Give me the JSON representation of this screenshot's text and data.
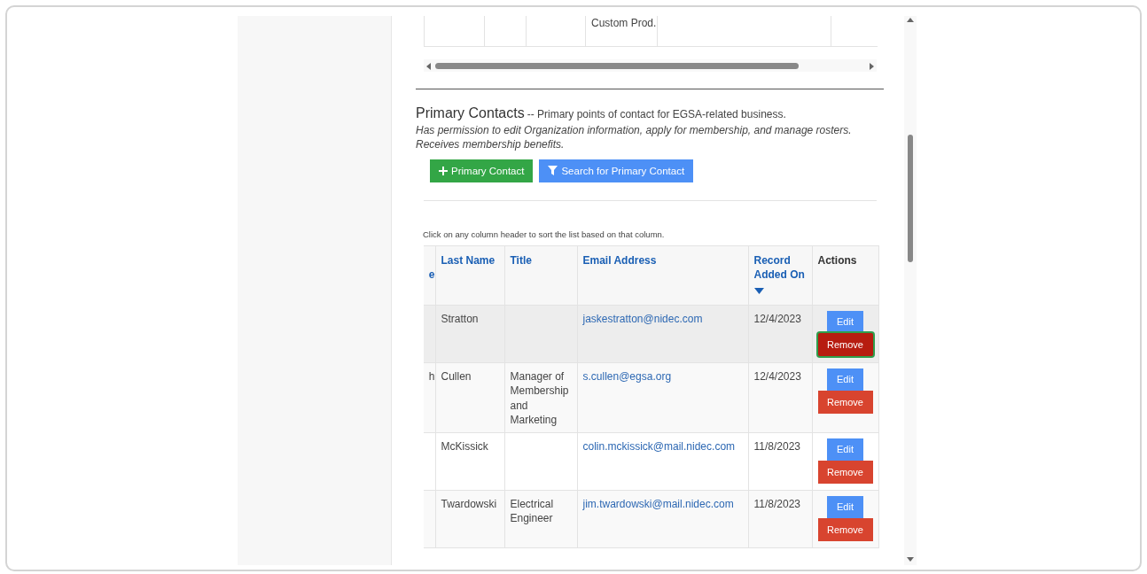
{
  "top_table": {
    "rows": [
      {
        "column_4": "Custom Prod."
      }
    ]
  },
  "section": {
    "title": "Primary Contacts",
    "subtitle": "-- Primary points of contact for EGSA-related business.",
    "description_lines": [
      "Has permission to edit Organization information, apply for membership, and manage rosters.",
      "Receives membership benefits."
    ],
    "buttons": [
      {
        "label": "Primary Contact",
        "kind": "add"
      },
      {
        "label": "Search for Primary Contact",
        "kind": "search"
      }
    ],
    "hint": "Click on any column header to sort the list based on that column.",
    "table": {
      "columns": [
        {
          "label": "e",
          "sortable": true,
          "sorted": false
        },
        {
          "label": "Last Name",
          "sortable": true,
          "sorted": false
        },
        {
          "label": "Title",
          "sortable": true,
          "sorted": false
        },
        {
          "label": "Email Address",
          "sortable": true,
          "sorted": false
        },
        {
          "label": "Record Added On",
          "sortable": true,
          "sorted": true
        },
        {
          "label": "Actions",
          "sortable": false,
          "sorted": false
        }
      ],
      "rows": [
        {
          "highlighted": true,
          "last_name": "Stratton",
          "email": "jaskestratton@nidec.com",
          "added": "12/4/2023",
          "actions": [
            {
              "label": "Edit",
              "kind": "edit",
              "focused": false
            },
            {
              "label": "Remove",
              "kind": "remove",
              "focused": true
            }
          ]
        },
        {
          "highlighted": false,
          "column_1": "h",
          "last_name": "Cullen",
          "title": "Manager of Membership and Marketing",
          "email": "s.cullen@egsa.org",
          "added": "12/4/2023",
          "actions": [
            {
              "label": "Edit",
              "kind": "edit",
              "focused": false
            },
            {
              "label": "Remove",
              "kind": "remove",
              "focused": false
            }
          ]
        },
        {
          "highlighted": false,
          "last_name": "McKissick",
          "email": "colin.mckissick@mail.nidec.com",
          "added": "11/8/2023",
          "actions": [
            {
              "label": "Edit",
              "kind": "edit",
              "focused": false
            },
            {
              "label": "Remove",
              "kind": "remove",
              "focused": false
            }
          ]
        },
        {
          "highlighted": false,
          "last_name": "Twardowski",
          "title": "Electrical Engineer",
          "email": "jim.twardowski@mail.nidec.com",
          "added": "11/8/2023",
          "actions": [
            {
              "label": "Edit",
              "kind": "edit",
              "focused": false
            },
            {
              "label": "Remove",
              "kind": "remove",
              "focused": false
            }
          ]
        }
      ]
    }
  }
}
